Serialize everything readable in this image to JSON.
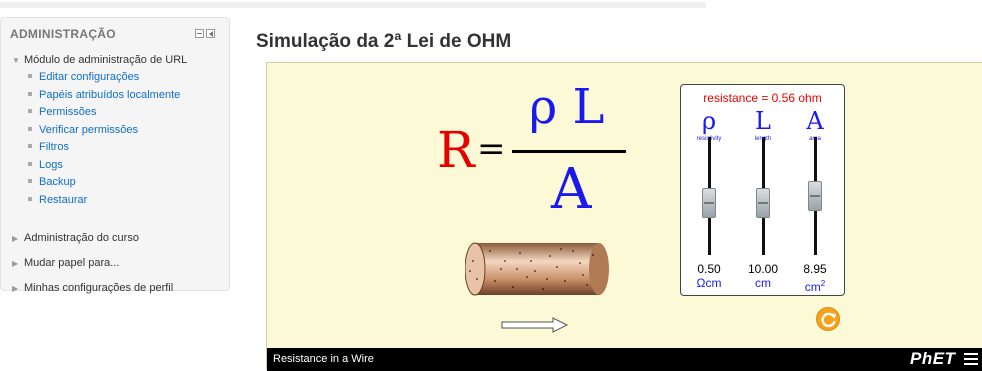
{
  "sidebar": {
    "title": "ADMINISTRAÇÃO",
    "module": "Módulo de administração de URL",
    "items": [
      {
        "label": "Editar configurações"
      },
      {
        "label": "Papéis atribuídos localmente"
      },
      {
        "label": "Permissões"
      },
      {
        "label": "Verificar permissões"
      },
      {
        "label": "Filtros"
      },
      {
        "label": "Logs"
      },
      {
        "label": "Backup"
      },
      {
        "label": "Restaurar"
      }
    ],
    "sections": [
      {
        "label": "Administração do curso"
      },
      {
        "label": "Mudar papel para..."
      },
      {
        "label": "Minhas configurações de perfil"
      }
    ]
  },
  "page": {
    "title": "Simulação da 2ª Lei de OHM"
  },
  "sim": {
    "equation": {
      "R": "R",
      "equals": "=",
      "numerator": "ρ L",
      "denominator": "A"
    },
    "resistance_label": "resistance = 0.56 ohm",
    "sliders": [
      {
        "symbol": "ρ",
        "name": "resistivity",
        "value": "0.50",
        "unit": "Ωcm",
        "level": 0.5
      },
      {
        "symbol": "L",
        "name": "length",
        "value": "10.00",
        "unit": "cm",
        "level": 0.5
      },
      {
        "symbol": "A",
        "name": "area",
        "value": "8.95",
        "unit": "cm",
        "unit_sup": "2",
        "level": 0.6
      }
    ],
    "footer_title": "Resistance in a Wire",
    "brand": "PhET",
    "accent_color": "#f7a21b"
  }
}
